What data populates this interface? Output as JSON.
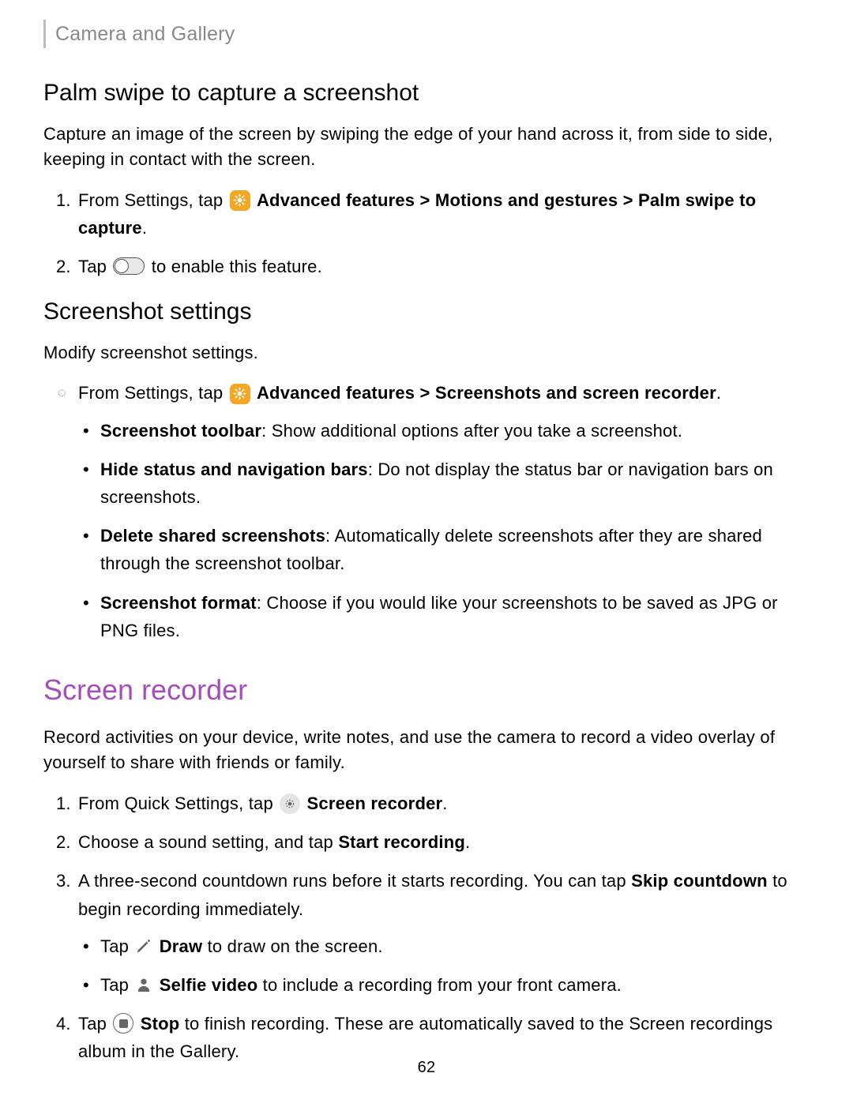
{
  "header": "Camera and Gallery",
  "s1": {
    "h": "Palm swipe to capture a screenshot",
    "p": "Capture an image of the screen by swiping the edge of your hand across it, from side to side, keeping in contact with the screen.",
    "li1a": "From Settings, tap ",
    "li1b": "Advanced features",
    "li1c": "Motions and gestures",
    "li1d": "Palm swipe to capture",
    "li2a": "Tap ",
    "li2b": " to enable this feature."
  },
  "s2": {
    "h": "Screenshot settings",
    "p": "Modify screenshot settings.",
    "lead_a": "From Settings, tap ",
    "lead_b": "Advanced features",
    "lead_c": "Screenshots and screen recorder",
    "b1t": "Screenshot toolbar",
    "b1d": ": Show additional options after you take a screenshot.",
    "b2t": "Hide status and navigation bars",
    "b2d": ": Do not display the status bar or navigation bars on screenshots.",
    "b3t": "Delete shared screenshots",
    "b3d": ": Automatically delete screenshots after they are shared through the screenshot toolbar.",
    "b4t": "Screenshot format",
    "b4d": ": Choose if you would like your screenshots to be saved as JPG or PNG files."
  },
  "s3": {
    "h": "Screen recorder",
    "p": "Record activities on your device, write notes, and use the camera to record a video overlay of yourself to share with friends or family.",
    "l1a": "From Quick Settings, tap ",
    "l1b": "Screen recorder",
    "l2a": "Choose a sound setting, and tap ",
    "l2b": "Start recording",
    "l3a": "A three-second countdown runs before it starts recording. You can tap ",
    "l3b": "Skip countdown",
    "l3c": " to begin recording immediately.",
    "s1a": "Tap ",
    "s1b": "Draw",
    "s1c": " to draw on the screen.",
    "s2a": "Tap ",
    "s2b": "Selfie video",
    "s2c": " to include a recording from your front camera.",
    "l4a": "Tap ",
    "l4b": "Stop",
    "l4c": " to finish recording. These are automatically saved to the Screen recordings album in the Gallery."
  },
  "sep": " > ",
  "pagenum": "62"
}
